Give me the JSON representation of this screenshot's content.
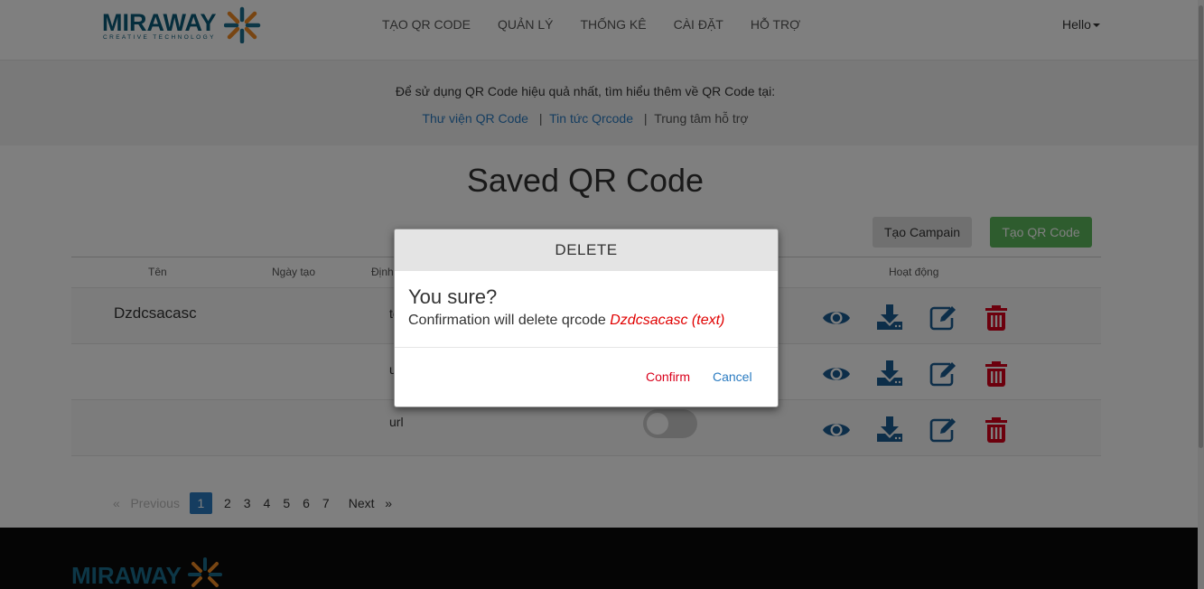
{
  "brand": {
    "name": "MIRAWAY",
    "tagline": "CREATIVE TECHNOLOGY"
  },
  "nav": {
    "items": [
      {
        "label": "TẠO QR CODE"
      },
      {
        "label": "QUẢN LÝ"
      },
      {
        "label": "THỐNG KÊ"
      },
      {
        "label": "CÀI ĐẶT"
      },
      {
        "label": "HỖ TRỢ"
      }
    ],
    "user_label": "Hello"
  },
  "info": {
    "text": "Để sử dụng QR Code hiệu quả nhất, tìm hiểu thêm về QR Code tại:",
    "links": [
      {
        "label": "Thư viện QR Code"
      },
      {
        "label": "Tin tức Qrcode"
      },
      {
        "label": "Trung tâm hỗ trợ"
      }
    ],
    "separator": "|"
  },
  "page": {
    "title": "Saved QR Code",
    "campaign_button": "Tạo Campain",
    "create_button": "Tạo QR Code"
  },
  "table": {
    "headers": {
      "name": "Tên",
      "created": "Ngày tạo",
      "type": "Định",
      "actions": "Hoạt động"
    },
    "rows": [
      {
        "name": "Dzdcsacasc",
        "type": "text"
      },
      {
        "name": "",
        "type": "url"
      },
      {
        "name": "",
        "type": "url",
        "enabled": false
      }
    ]
  },
  "pagination": {
    "previous": "Previous",
    "next": "Next",
    "prev_symbol": "«",
    "next_symbol": "»",
    "pages": [
      "1",
      "2",
      "3",
      "4",
      "5",
      "6",
      "7"
    ],
    "current": "1"
  },
  "modal": {
    "title": "DELETE",
    "question": "You sure?",
    "message": "Confirmation will delete qrcode",
    "target": "Dzdcsacasc (text)",
    "confirm": "Confirm",
    "cancel": "Cancel"
  },
  "colors": {
    "brand": "#0a5b78",
    "link": "#2a7bc1",
    "create_button": "#5cb85c",
    "danger": "#d9001b",
    "footer": "#0b0b0b"
  },
  "icons": [
    "eye-icon",
    "download-icon",
    "edit-icon",
    "trash-icon",
    "caret-down-icon"
  ]
}
